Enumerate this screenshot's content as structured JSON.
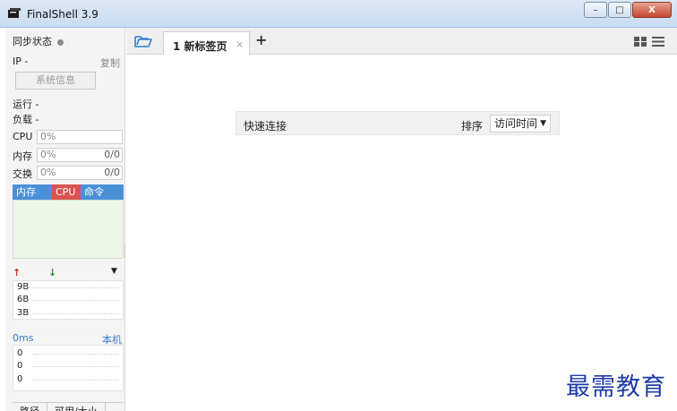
{
  "window": {
    "title": "FinalShell 3.9",
    "controls": {
      "minimize": "–",
      "maximize": "□",
      "close": "X"
    }
  },
  "sidebar": {
    "sync_status": "同步状态",
    "ip_label": "IP -",
    "copy_label": "复制",
    "sysinfo_button": "系统信息",
    "run_label": "运行 -",
    "load_label": "负载 -",
    "metrics": [
      {
        "label": "CPU",
        "value": "0%",
        "extra": ""
      },
      {
        "label": "内存",
        "value": "0%",
        "extra": "0/0"
      },
      {
        "label": "交换",
        "value": "0%",
        "extra": "0/0"
      }
    ],
    "process_tabs": [
      "内存",
      "CPU",
      "命令"
    ],
    "network": {
      "up_icon": "↑",
      "down_icon": "↓",
      "menu_icon": "▼",
      "lines": [
        "9B",
        "6B",
        "3B"
      ]
    },
    "ping": {
      "label": "0ms",
      "target": "本机",
      "lines": [
        "0",
        "0",
        "0"
      ]
    },
    "bottom_tabs": [
      "路径",
      "可用/大小"
    ]
  },
  "tabs": {
    "active_label": "1 新标签页",
    "close_icon": "×",
    "add_icon": "+"
  },
  "quick_connect": {
    "label": "快速连接",
    "sort_label": "排序",
    "sort_value": "访问时间",
    "sort_caret": "▼"
  },
  "watermark": "最需教育",
  "colors": {
    "accent_blue": "#4a90d9",
    "cpu_red": "#d9534f",
    "proc_bg": "#eef6ea",
    "up_red": "#c0392b",
    "down_green": "#2e8b2e",
    "watermark_blue": "#1e3aa8"
  }
}
